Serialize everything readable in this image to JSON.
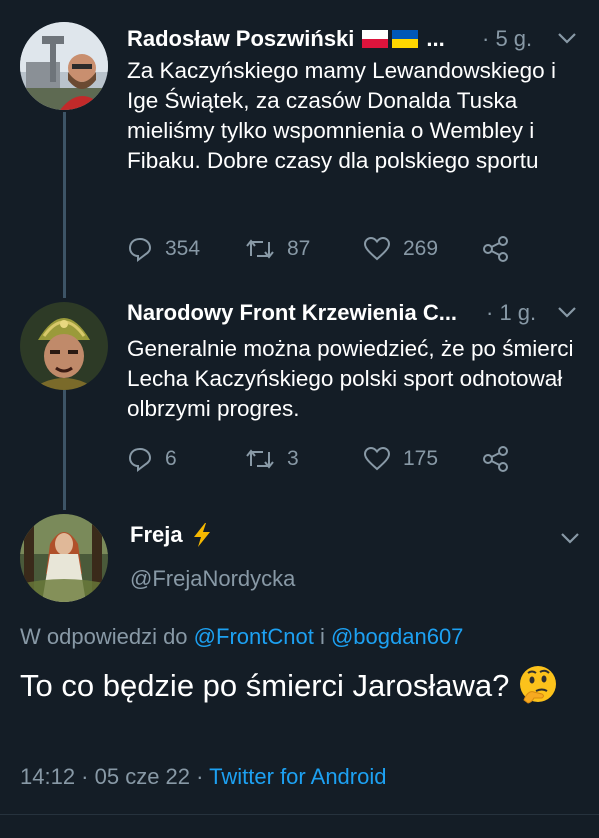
{
  "tweets": [
    {
      "author": "Radosław Poszwiński",
      "flags": "🇵🇱🇺🇦",
      "ellipsis": "...",
      "time": "· 5 g.",
      "text": "Za Kaczyńskiego  mamy Lewandowskiego i Ige Świątek, za czasów Donalda Tuska mieliśmy tylko wspomnienia o Wembley i Fibaku. Dobre czasy dla polskiego sportu",
      "replies": "354",
      "retweets": "87",
      "likes": "269"
    },
    {
      "author": "Narodowy Front Krzewienia C...",
      "time": "· 1 g.",
      "text": "Generalnie można powiedzieć, że po śmierci Lecha Kaczyńskiego polski sport odnotował olbrzymi progres.",
      "replies": "6",
      "retweets": "3",
      "likes": "175"
    }
  ],
  "main_tweet": {
    "author": "Freja",
    "author_emoji": "⚡",
    "handle": "@FrejaNordycka",
    "reply_prefix": "W odpowiedzi do",
    "reply_user1": "@FrontCnot",
    "reply_joiner": "i",
    "reply_user2": "@bogdan607",
    "text": "To co będzie po śmierci Jarosława?",
    "emoji": "🤔",
    "time": "14:12 · 05 cze 22 ·",
    "source": "Twitter for Android"
  },
  "colors": {
    "background": "#141d26",
    "secondary_text": "#8899a6",
    "link": "#1da1f2",
    "thread_line": "#3d5466"
  },
  "icons": [
    "reply-icon",
    "retweet-icon",
    "like-icon",
    "share-icon",
    "chevron-down-icon",
    "lightning-icon",
    "thinking-face-icon"
  ]
}
